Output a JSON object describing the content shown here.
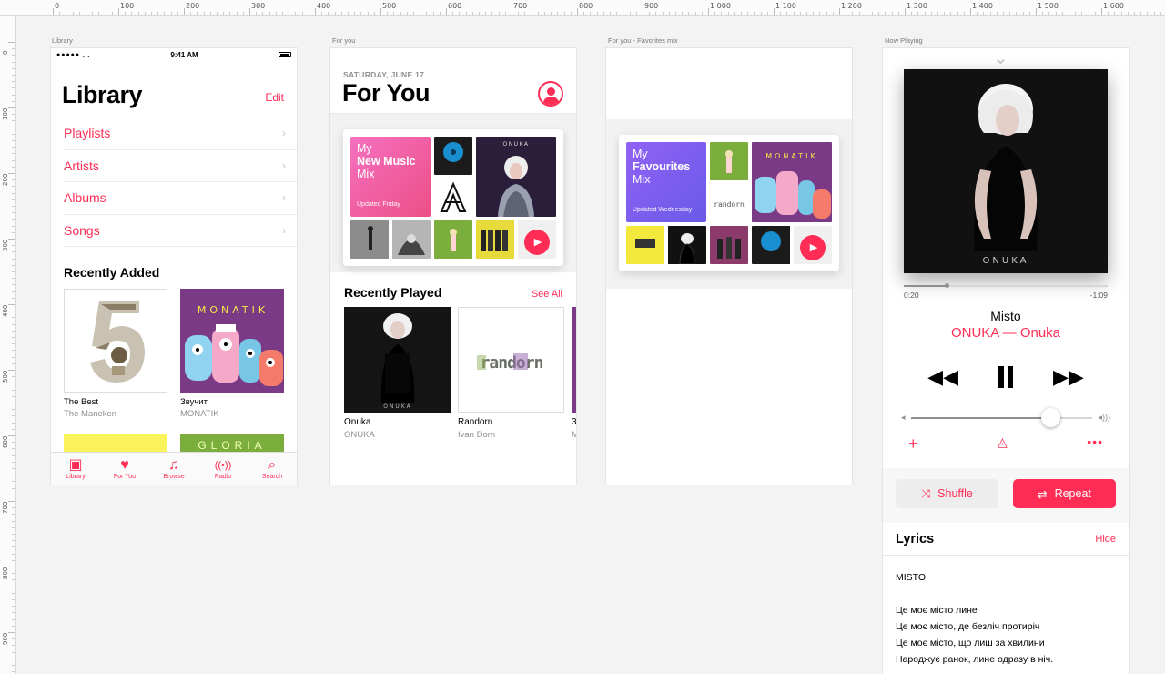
{
  "ruler": {
    "top_labels": [
      "0",
      "100",
      "200",
      "300",
      "400",
      "500",
      "600",
      "700",
      "800",
      "900",
      "1 000",
      "1 100",
      "1 200",
      "1 300",
      "1 400",
      "1 500",
      "1 600"
    ],
    "left_labels": [
      "0",
      "100",
      "200",
      "300",
      "400",
      "500",
      "600",
      "700",
      "800",
      "900"
    ]
  },
  "artboards": {
    "library": "Library",
    "for_you": "For you",
    "favorites": "For you - Favorites mix",
    "now_playing": "Now Playing"
  },
  "status": {
    "time": "9:41 AM"
  },
  "library": {
    "title": "Library",
    "edit": "Edit",
    "rows": [
      "Playlists",
      "Artists",
      "Albums",
      "Songs"
    ],
    "recently_added": "Recently Added",
    "albums": [
      {
        "title": "The Best",
        "artist": "The Maneken"
      },
      {
        "title": "Звучит",
        "artist": "MONATIK"
      }
    ],
    "tabs": [
      "Library",
      "For You",
      "Browse",
      "Radio",
      "Search"
    ]
  },
  "for_you": {
    "date": "SATURDAY, JUNE 17",
    "title": "For You",
    "mix": {
      "line1": "My",
      "line2": "New Music",
      "line3": "Mix",
      "updated": "Updated Friday"
    },
    "recently_played": "Recently Played",
    "see_all": "See All",
    "items": [
      {
        "title": "Onuka",
        "artist": "ONUKA"
      },
      {
        "title": "Randorn",
        "artist": "Ivan Dorn"
      }
    ],
    "peek_title": "3",
    "peek_artist": "M"
  },
  "favorites": {
    "mix": {
      "line1": "My",
      "line2": "Favourites",
      "line3": "Mix",
      "updated": "Updated Wednesday"
    }
  },
  "now_playing": {
    "art_text": "ONUKA",
    "elapsed": "0:20",
    "remaining": "-1:09",
    "progress": 0.21,
    "volume": 0.77,
    "song": "Misto",
    "artist": "ONUKA — Onuka",
    "shuffle": "Shuffle",
    "repeat": "Repeat",
    "lyrics_title": "Lyrics",
    "hide": "Hide",
    "lyrics": [
      "MISTO",
      "Це моє місто лине",
      "Це моє місто, де безліч протиріч",
      "Це моє місто, що лиш за хвилини",
      "Народжує ранок, лине одразу в ніч."
    ]
  },
  "colors": {
    "accent": "#ff2d55",
    "mix_new": "#f35fa0",
    "mix_fav": "#7d5cf0"
  }
}
